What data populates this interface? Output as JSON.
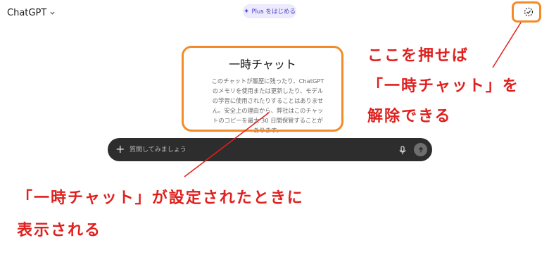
{
  "header": {
    "app_name": "ChatGPT",
    "plus_button_label": "Plus をはじめる"
  },
  "temporary_chat": {
    "title": "一時チャット",
    "description": "このチャットが履歴に残ったり、ChatGPT のメモリを使用または更新したり、モデルの学習に使用されたりすることはありません。安全上の理由から、弊社はこのチャットのコピーを最大 30 日間保管することがあります。"
  },
  "composer": {
    "placeholder": "質問してみましょう"
  },
  "annotations": {
    "right_line1": "ここを押せば",
    "right_line2": "「一時チャット」を",
    "right_line3": "解除できる",
    "bottom_line1": "「一時チャット」が設定されたときに",
    "bottom_line2": "表示される",
    "highlight_color": "#f28c28",
    "text_color": "#e0201e"
  },
  "icons": [
    "chevron-down-icon",
    "sparkle-icon",
    "temporary-chat-icon",
    "plus-icon",
    "microphone-icon",
    "arrow-up-icon"
  ]
}
